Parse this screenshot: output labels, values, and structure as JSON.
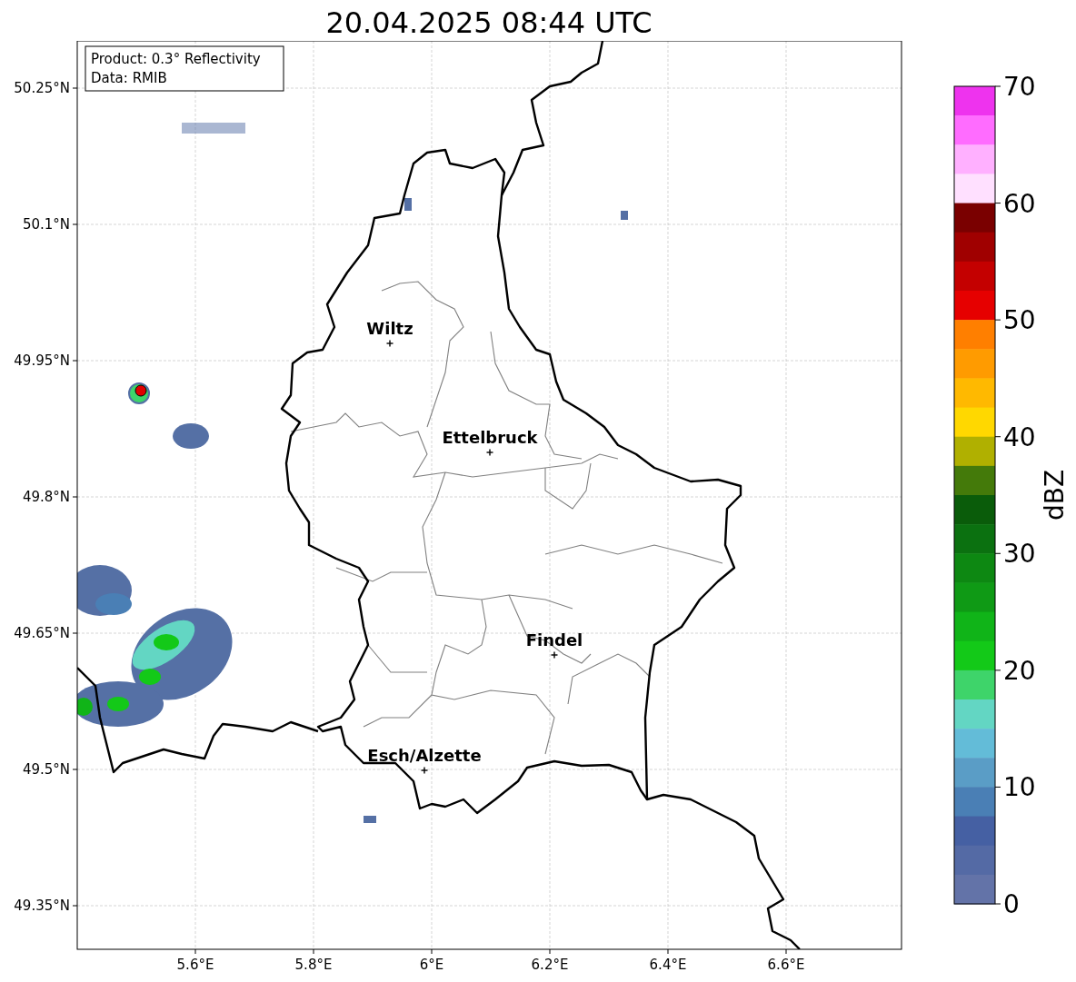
{
  "title": "20.04.2025 08:44 UTC",
  "info_box": {
    "lines": [
      "Product: 0.3° Reflectivity",
      "Data: RMIB"
    ]
  },
  "map": {
    "y_ticks": [
      "50.25°N",
      "50.1°N",
      "49.95°N",
      "49.8°N",
      "49.65°N",
      "49.5°N",
      "49.35°N"
    ],
    "x_ticks": [
      "5.6°E",
      "5.8°E",
      "6°E",
      "6.2°E",
      "6.4°E",
      "6.6°E"
    ],
    "cities": [
      {
        "name": "Wiltz"
      },
      {
        "name": "Ettelbruck"
      },
      {
        "name": "Findel"
      },
      {
        "name": "Esch/Alzette"
      }
    ]
  },
  "colorbar": {
    "label": "dBZ",
    "ticks": [
      "70",
      "60",
      "50",
      "40",
      "30",
      "20",
      "10",
      "0"
    ],
    "segments": [
      {
        "color": "#ee33ee"
      },
      {
        "color": "#ff6cff"
      },
      {
        "color": "#ffb0ff"
      },
      {
        "color": "#ffe0ff"
      },
      {
        "color": "#7a0000"
      },
      {
        "color": "#a00000"
      },
      {
        "color": "#c40000"
      },
      {
        "color": "#e60000"
      },
      {
        "color": "#ff7f00"
      },
      {
        "color": "#ff9b00"
      },
      {
        "color": "#ffb900"
      },
      {
        "color": "#ffd800"
      },
      {
        "color": "#b0b000"
      },
      {
        "color": "#447a0a"
      },
      {
        "color": "#0a5c0a"
      },
      {
        "color": "#0b7110"
      },
      {
        "color": "#0d8812"
      },
      {
        "color": "#0f9a15"
      },
      {
        "color": "#10b418"
      },
      {
        "color": "#13c918"
      },
      {
        "color": "#3ed46a"
      },
      {
        "color": "#63d6c3"
      },
      {
        "color": "#63bcd8"
      },
      {
        "color": "#5a9dc6"
      },
      {
        "color": "#4a7fb5"
      },
      {
        "color": "#4560a3"
      },
      {
        "color": "#546aa5"
      },
      {
        "color": "#6373a8"
      }
    ]
  }
}
